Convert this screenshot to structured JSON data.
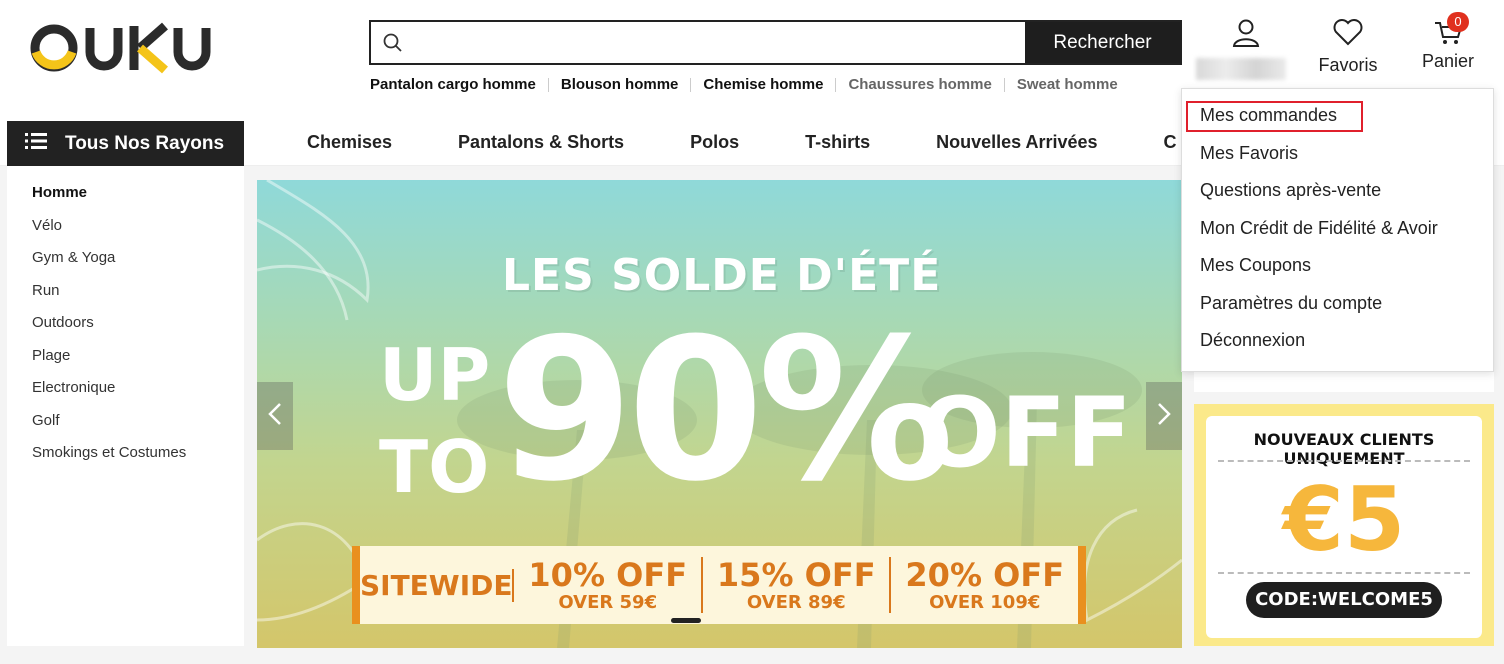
{
  "header": {
    "logo_text": "OUKU",
    "search": {
      "placeholder": "",
      "value": "",
      "button_label": "Rechercher"
    },
    "hot_searches": [
      "Pantalon cargo homme",
      "Blouson homme",
      "Chemise homme",
      "Chaussures homme",
      "Sweat homme"
    ],
    "favorites_label": "Favoris",
    "cart_label": "Panier",
    "cart_count": "0"
  },
  "nav": {
    "all_categories_label": "Tous Nos Rayons",
    "links": [
      "Chemises",
      "Pantalons & Shorts",
      "Polos",
      "T-shirts",
      "Nouvelles Arrivées",
      "C"
    ]
  },
  "sidebar": {
    "items": [
      "Homme",
      "Vélo",
      "Gym & Yoga",
      "Run",
      "Outdoors",
      "Plage",
      "Electronique",
      "Golf",
      "Smokings et Costumes"
    ]
  },
  "banner": {
    "title": "LES SOLDE D'ÉTÉ",
    "up": "UP",
    "to": "TO",
    "big_value": "90%",
    "off": "OFF",
    "promos": [
      {
        "big": "SITEWIDE",
        "small": ""
      },
      {
        "big": "10% OFF",
        "small": "OVER 59€"
      },
      {
        "big": "15% OFF",
        "small": "OVER 89€"
      },
      {
        "big": "20% OFF",
        "small": "OVER 109€"
      }
    ]
  },
  "coupon": {
    "heading": "NOUVEAUX CLIENTS UNIQUEMENT",
    "value": "€5",
    "code": "CODE:WELCOME5"
  },
  "account_menu": {
    "items": [
      "Mes commandes",
      "Mes Favoris",
      "Questions après-vente",
      "Mon Crédit de Fidélité & Avoir",
      "Mes Coupons",
      "Paramètres du compte",
      "Déconnexion"
    ],
    "highlighted_index": 0
  },
  "colors": {
    "brand_dark": "#2b2b2b",
    "brand_yellow": "#f4c419",
    "accent_orange": "#d9781c",
    "badge_red": "#e0301e",
    "highlight_red": "#e0202c"
  }
}
